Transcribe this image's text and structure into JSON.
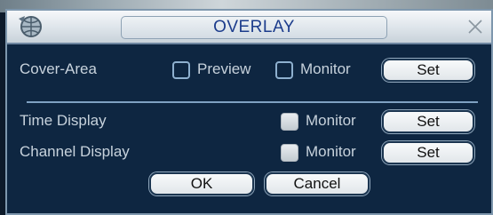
{
  "dialog": {
    "title": "OVERLAY"
  },
  "cover_area": {
    "label": "Cover-Area",
    "preview_label": "Preview",
    "monitor_label": "Monitor",
    "set_label": "Set"
  },
  "time_display": {
    "label": "Time Display",
    "monitor_label": "Monitor",
    "set_label": "Set"
  },
  "channel_display": {
    "label": "Channel Display",
    "monitor_label": "Monitor",
    "set_label": "Set"
  },
  "footer": {
    "ok_label": "OK",
    "cancel_label": "Cancel"
  }
}
